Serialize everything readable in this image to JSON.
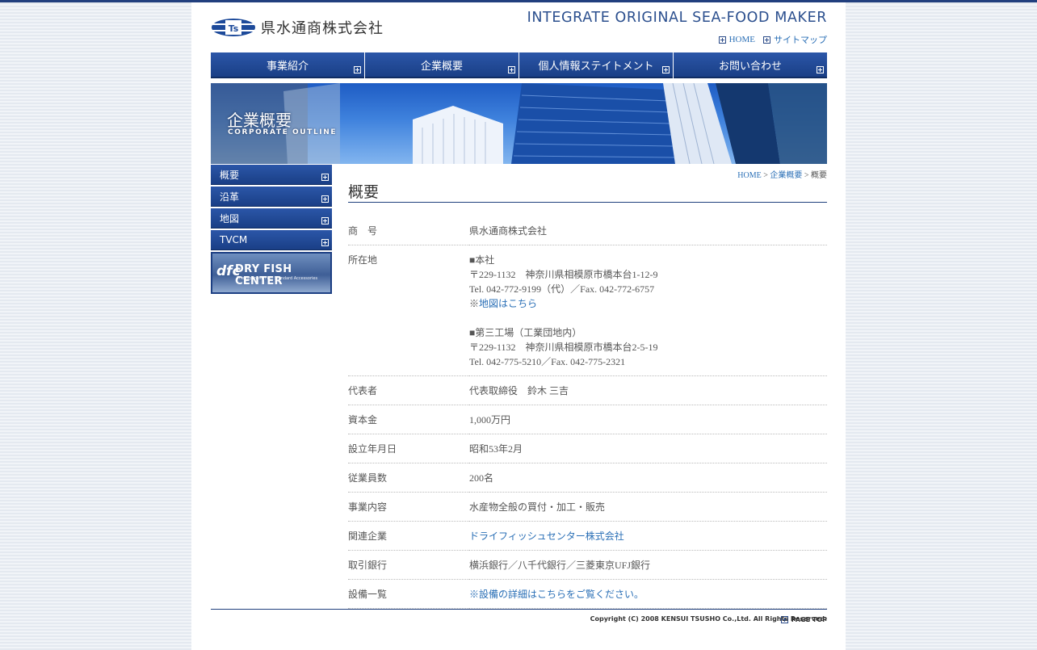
{
  "header": {
    "company_name": "県水通商株式会社",
    "tagline": "INTEGRATE ORIGINAL SEA-FOOD MAKER",
    "links": {
      "home": "HOME",
      "sitemap": "サイトマップ"
    }
  },
  "gnav": [
    "事業紹介",
    "企業概要",
    "個人情報ステイトメント",
    "お問い合わせ"
  ],
  "banner": {
    "title": "企業概要",
    "subtitle": "CORPORATE OUTLINE"
  },
  "side_nav": [
    "概要",
    "沿革",
    "地図",
    "TVCM"
  ],
  "dfc_banner": {
    "name": "DRY FISH CENTER",
    "mark": "dfc",
    "sub": "The Japanese Fish Standard Accessories"
  },
  "breadcrumb": {
    "home": "HOME",
    "sep": ">",
    "parent": "企業概要",
    "current": "概要"
  },
  "page_title": "概要",
  "info": {
    "r1": {
      "k": "商　号",
      "v": "県水通商株式会社"
    },
    "r2": {
      "k": "所在地",
      "l1": "■本社",
      "l2": "〒229-1132　神奈川県相模原市橋本台1-12-9",
      "l3": "Tel. 042-772-9199（代）／Fax. 042-772-6757",
      "note": "※",
      "map_link": "地図はこちら",
      "l5": "■第三工場（工業団地内）",
      "l6": "〒229-1132　神奈川県相模原市橋本台2-5-19",
      "l7": "Tel. 042-775-5210／Fax. 042-775-2321"
    },
    "r3": {
      "k": "代表者",
      "v": "代表取締役　鈴木 三吉"
    },
    "r4": {
      "k": "資本金",
      "v": "1,000万円"
    },
    "r5": {
      "k": "設立年月日",
      "v": "昭和53年2月"
    },
    "r6": {
      "k": "従業員数",
      "v": "200名"
    },
    "r7": {
      "k": "事業内容",
      "v": "水産物全般の買付・加工・販売"
    },
    "r8": {
      "k": "関連企業",
      "v": "ドライフィッシュセンター株式会社"
    },
    "r9": {
      "k": "取引銀行",
      "v": "横浜銀行／八千代銀行／三菱東京UFJ銀行"
    },
    "r10": {
      "k": "設備一覧",
      "note": "※",
      "v": "設備の詳細はこちらをご覧ください。"
    }
  },
  "pagetop": "PAGE TOP",
  "copyright": "Copyright (C) 2008 KENSUI TSUSHO Co.,Ltd. All Rights Reserved.",
  "colors": {
    "navy": "#213f7e",
    "link": "#2a6fb6"
  }
}
